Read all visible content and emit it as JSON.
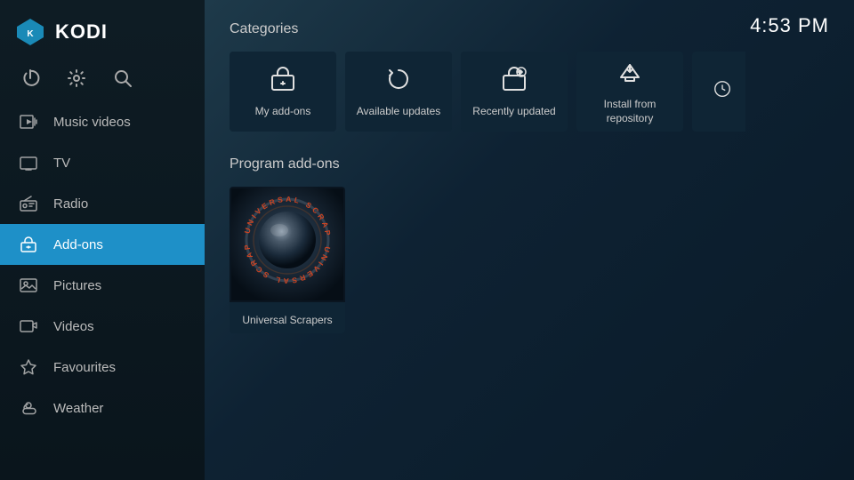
{
  "app": {
    "logo_text": "KODI",
    "time": "4:53 PM"
  },
  "sidebar": {
    "controls": [
      {
        "id": "power",
        "label": "Power",
        "icon": "⏻"
      },
      {
        "id": "settings",
        "label": "Settings",
        "icon": "⚙"
      },
      {
        "id": "search",
        "label": "Search",
        "icon": "🔍"
      }
    ],
    "nav_items": [
      {
        "id": "music-videos",
        "label": "Music videos",
        "icon": "music-video",
        "active": false
      },
      {
        "id": "tv",
        "label": "TV",
        "icon": "tv",
        "active": false
      },
      {
        "id": "radio",
        "label": "Radio",
        "icon": "radio",
        "active": false
      },
      {
        "id": "add-ons",
        "label": "Add-ons",
        "icon": "addon",
        "active": true
      },
      {
        "id": "pictures",
        "label": "Pictures",
        "icon": "picture",
        "active": false
      },
      {
        "id": "videos",
        "label": "Videos",
        "icon": "video",
        "active": false
      },
      {
        "id": "favourites",
        "label": "Favourites",
        "icon": "star",
        "active": false
      },
      {
        "id": "weather",
        "label": "Weather",
        "icon": "weather",
        "active": false
      }
    ]
  },
  "main": {
    "categories_title": "Categories",
    "program_addons_title": "Program add-ons",
    "categories": [
      {
        "id": "my-add-ons",
        "label": "My add-ons",
        "icon": "addon-box"
      },
      {
        "id": "available-updates",
        "label": "Available updates",
        "icon": "refresh"
      },
      {
        "id": "recently-updated",
        "label": "Recently updated",
        "icon": "addon-box-updated"
      },
      {
        "id": "install-from-repository",
        "label": "Install from\nrepository",
        "icon": "repo"
      }
    ],
    "addons": [
      {
        "id": "universal-scrapers",
        "label": "Universal Scrapers"
      }
    ]
  }
}
